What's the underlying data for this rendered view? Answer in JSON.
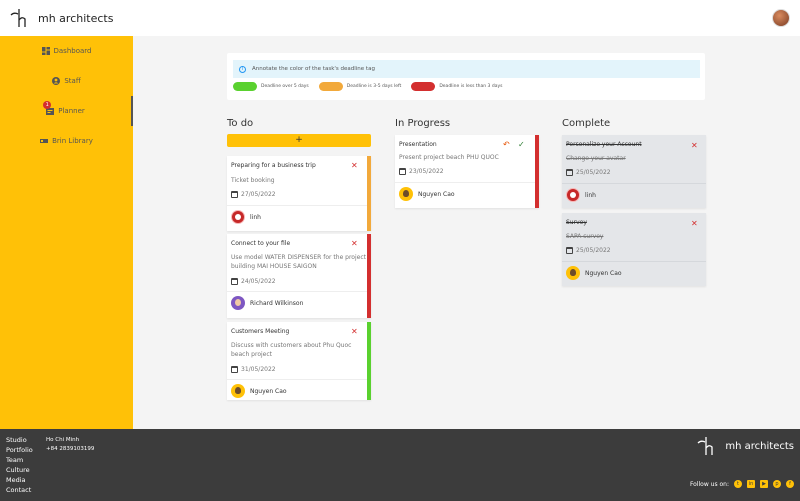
{
  "header": {
    "brand": "mh architects"
  },
  "sidebar": {
    "items": [
      {
        "label": "Dashboard",
        "icon": "dashboard-icon"
      },
      {
        "label": "Staff",
        "icon": "user-circle-icon"
      },
      {
        "label": "Planner",
        "icon": "planner-icon",
        "badge": "1"
      },
      {
        "label": "Brin Library",
        "icon": "library-icon"
      }
    ]
  },
  "legend": {
    "info": "Annotate the color of the task's deadline tag",
    "items": [
      {
        "label": "Deadline over 5 days",
        "color": "#5ad12f"
      },
      {
        "label": "Deadline is 3-5 days left",
        "color": "#f2a93b"
      },
      {
        "label": "Deadline is less than 3 days",
        "color": "#d32f2f"
      }
    ]
  },
  "columns": {
    "todo": {
      "title": "To do",
      "add": "+",
      "cards": [
        {
          "title": "Preparing for a business trip",
          "desc1": "Ticket booking",
          "desc2": "",
          "date": "27/05/2022",
          "user": "linh",
          "color": "#f2a93b"
        },
        {
          "title": "Connect to your file",
          "desc1": "Use model WATER DISPENSER for the project",
          "desc2": "building MAI HOUSE SAIGON",
          "date": "24/05/2022",
          "user": "Richard Wilkinson",
          "color": "#d32f2f"
        },
        {
          "title": "Customers Meeting",
          "desc1": "Discuss with customers about Phu Quoc",
          "desc2": "beach project",
          "date": "31/05/2022",
          "user": "Nguyen Cao",
          "color": "#5ad12f"
        }
      ]
    },
    "progress": {
      "title": "In Progress",
      "cards": [
        {
          "title": "Presentation",
          "desc1": "Present project beach PHU QUOC",
          "date": "23/05/2022",
          "user": "Nguyen Cao",
          "color": "#d32f2f"
        }
      ]
    },
    "complete": {
      "title": "Complete",
      "cards": [
        {
          "title": "Personalize your Account",
          "desc1": "Change your avatar",
          "date": "25/05/2022",
          "user": "linh"
        },
        {
          "title": "Survey",
          "desc1": "SAPA survey",
          "date": "25/05/2022",
          "user": "Nguyen Cao"
        }
      ]
    }
  },
  "footer": {
    "links": [
      "Studio",
      "Portfolio",
      "Team",
      "Culture",
      "Media",
      "Contact"
    ],
    "city": "Ho Chi Minh",
    "phone": "+84 2839103199",
    "brand": "mh architects",
    "follow": "Follow us on:",
    "socials": [
      "twitter-icon",
      "linkedin-icon",
      "youtube-icon",
      "pinterest-icon",
      "facebook-icon"
    ]
  },
  "colors": {
    "accent": "#ffc107",
    "footer": "#3c3c3c"
  }
}
